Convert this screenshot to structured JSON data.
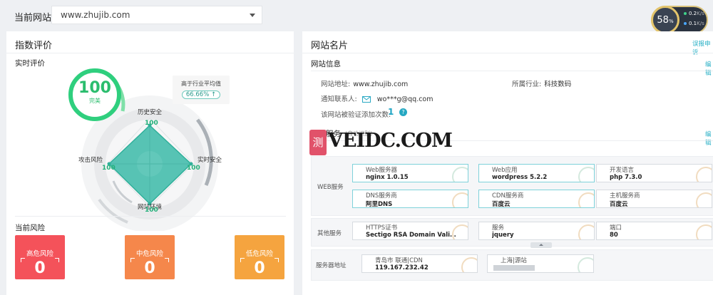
{
  "topbar": {
    "site_label": "当前网站",
    "site_value": "www.zhujib.com",
    "speed": {
      "percent": "58",
      "unit": "%",
      "up": "0.2",
      "down": "0.1",
      "rate_unit": "K/s"
    }
  },
  "left": {
    "title": "指数评价",
    "realtime_label": "实时评价",
    "score": {
      "value": "100",
      "label": "完美"
    },
    "badge": {
      "text": "高于行业平均值",
      "value": "66.66% ↑"
    },
    "radar": {
      "axes": [
        {
          "label": "历史安全",
          "value": "100"
        },
        {
          "label": "实时安全",
          "value": "100"
        },
        {
          "label": "网站环境",
          "value": "100"
        },
        {
          "label": "攻击风险",
          "value": "100"
        }
      ]
    },
    "risk_title": "当前风险",
    "risks": [
      {
        "label": "高危风险",
        "value": "0",
        "color": "#f4525a"
      },
      {
        "label": "中危风险",
        "value": "0",
        "color": "#f5874b"
      },
      {
        "label": "低危风险",
        "value": "0",
        "color": "#f5a43f"
      }
    ]
  },
  "right": {
    "title": "网站名片",
    "top_link": "误报申诉",
    "info_title": "网站信息",
    "edit_label": "编辑",
    "site_addr_label": "网站地址:",
    "site_addr": "www.zhujib.com",
    "industry_label": "所属行业:",
    "industry": "科技数码",
    "contact_label": "通知联系人:",
    "contact": "wo***g@qq.com",
    "verify_label": "该网站被验证添加次数:",
    "verify_count": "1",
    "service_title": "网站服务",
    "service_sub": "(自动识别)",
    "service_edit": "编辑",
    "groups": [
      {
        "label": "WEB服务",
        "cards": [
          {
            "title": "Web服务器",
            "value": "nginx 1.0.15"
          },
          {
            "title": "Web应用",
            "value": "wordpress 5.2.2"
          },
          {
            "title": "开发语言",
            "value": "php 7.3.0"
          },
          {
            "title": "DNS服务商",
            "value": "阿里DNS"
          },
          {
            "title": "CDN服务商",
            "value": "百度云"
          },
          {
            "title": "主机服务商",
            "value": "百度云"
          }
        ]
      },
      {
        "label": "其他服务",
        "cards": [
          {
            "title": "HTTPS证书",
            "value": "Sectigo RSA Domain Validati..."
          },
          {
            "title": "服务",
            "value": "jquery"
          },
          {
            "title": "端口",
            "value": "80"
          }
        ]
      },
      {
        "label": "服务器地址",
        "cards": [
          {
            "title": "青岛市 联通|CDN",
            "value": "119.167.232.42"
          },
          {
            "title": "上海|源站",
            "value": ""
          }
        ]
      }
    ]
  },
  "watermark": {
    "icon": "测",
    "text": "VEIDC.COM"
  }
}
